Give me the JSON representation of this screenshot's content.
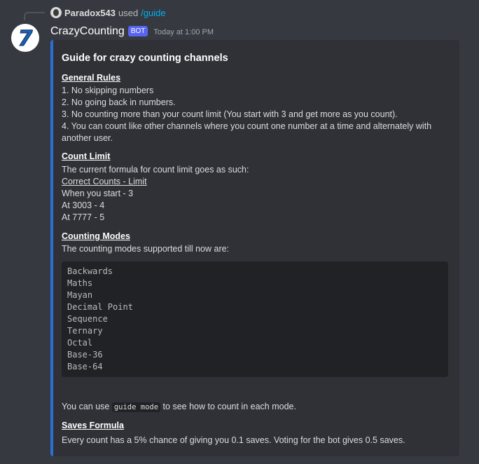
{
  "reply": {
    "username": "Paradox543",
    "used_text": "used",
    "command": "/guide"
  },
  "message": {
    "username": "CrazyCounting",
    "bot_tag": "BOT",
    "timestamp": "Today at 1:00 PM",
    "avatar_glyph": "7"
  },
  "embed": {
    "accent_color": "#2b6fd6",
    "title": "Guide for crazy counting channels",
    "general_rules": {
      "heading": "General Rules",
      "lines": [
        "1. No skipping numbers",
        "2. No going back in numbers.",
        "3. No counting more than your count limit (You start with 3 and get more as you count).",
        "4. You can count like other channels where you count one number at a time and alternately with",
        "another user."
      ]
    },
    "count_limit": {
      "heading": "Count Limit",
      "intro": "The current formula for count limit goes as such:",
      "table_header": "Correct Counts - Limit",
      "lines": [
        "When you start - 3",
        "At 3003 - 4",
        "At 7777 - 5"
      ]
    },
    "counting_modes": {
      "heading": "Counting Modes",
      "intro": "The counting modes supported till now are:",
      "modes": [
        "Backwards",
        "Maths",
        "Mayan",
        "Decimal Point",
        "Sequence",
        "Ternary",
        "Octal",
        "Base-36",
        "Base-64"
      ],
      "usage_prefix": "You can use",
      "usage_code": "guide mode",
      "usage_suffix": "to see how to count in each mode."
    },
    "saves_formula": {
      "heading": "Saves Formula",
      "text": "Every count has a 5% chance of giving you 0.1 saves. Voting for the bot gives 0.5 saves."
    }
  }
}
